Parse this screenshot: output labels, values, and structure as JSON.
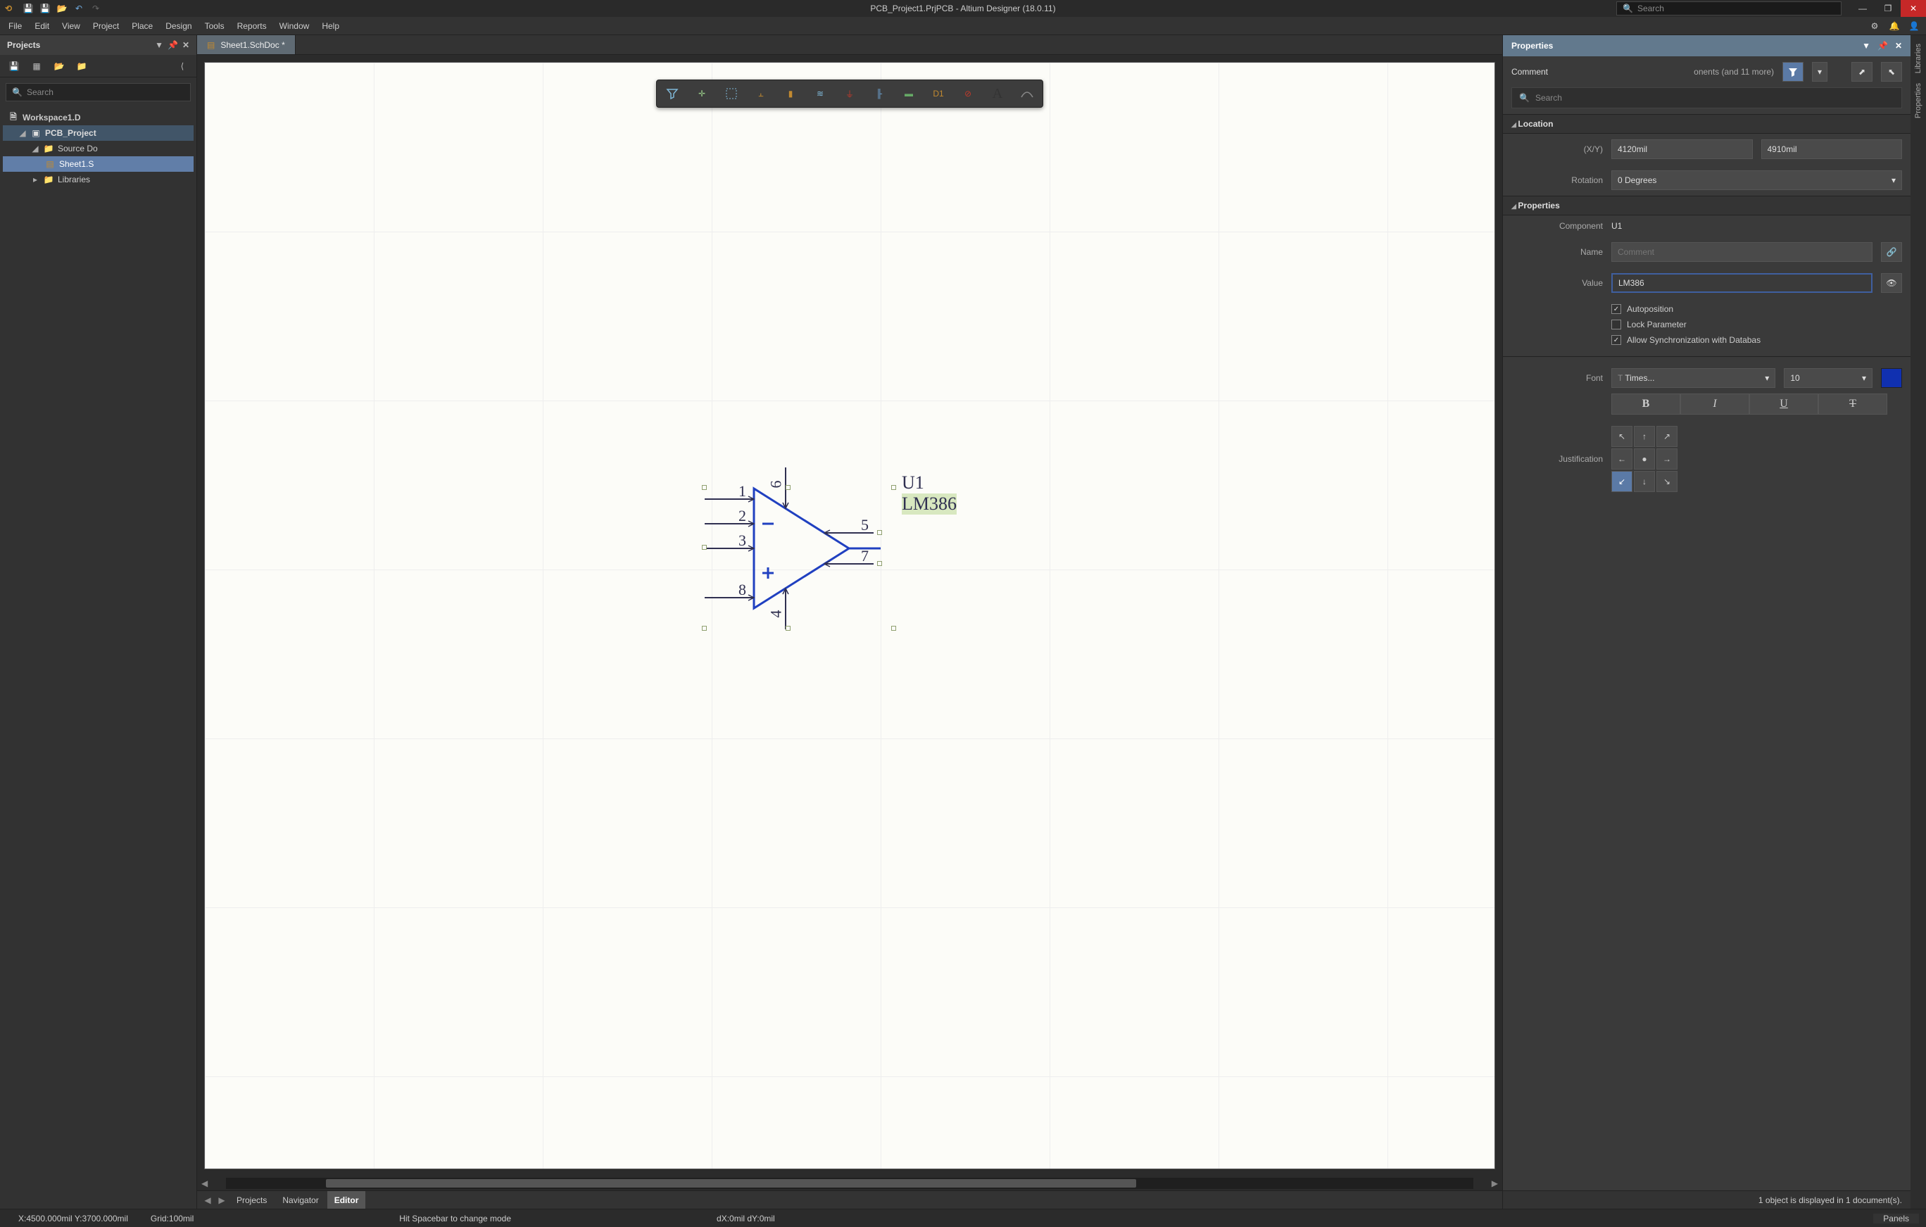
{
  "title": "PCB_Project1.PrjPCB - Altium Designer (18.0.11)",
  "global_search_placeholder": "Search",
  "menu": [
    "File",
    "Edit",
    "View",
    "Project",
    "Place",
    "Design",
    "Tools",
    "Reports",
    "Window",
    "Help"
  ],
  "projects_panel": {
    "title": "Projects",
    "search_placeholder": "Search",
    "workspace": "Workspace1.D",
    "project": "PCB_Project",
    "source_group": "Source Do",
    "sheet": "Sheet1.S",
    "libraries": "Libraries"
  },
  "open_tab": {
    "label": "Sheet1.SchDoc *"
  },
  "component": {
    "designator": "U1",
    "comment": "LM386",
    "pins": {
      "p1": "1",
      "p2": "2",
      "p3": "3",
      "p4": "4",
      "p5": "5",
      "p6": "6",
      "p7": "7",
      "p8": "8"
    }
  },
  "properties_panel": {
    "title": "Properties",
    "scope": "Comment",
    "filter_more": "onents (and 11 more)",
    "search_placeholder": "Search",
    "sections": {
      "location": "Location",
      "properties": "Properties"
    },
    "location": {
      "xy_label": "(X/Y)",
      "x": "4120mil",
      "y": "4910mil",
      "rotation_label": "Rotation",
      "rotation": "0 Degrees"
    },
    "prop": {
      "component_label": "Component",
      "component": "U1",
      "name_label": "Name",
      "name_placeholder": "Comment",
      "value_label": "Value",
      "value": "LM386",
      "autoposition": "Autoposition",
      "lock": "Lock Parameter",
      "allowsync": "Allow Synchronization with Databas",
      "font_label": "Font",
      "font_name": "Times...",
      "font_size": "10",
      "justification": "Justification"
    },
    "status": "1 object is displayed in 1 document(s)."
  },
  "bottom_tabs": {
    "projects": "Projects",
    "navigator": "Navigator",
    "editor": "Editor"
  },
  "dock_tabs": {
    "libraries": "Libraries",
    "properties": "Properties"
  },
  "status": {
    "coords": "X:4500.000mil Y:3700.000mil",
    "grid": "Grid:100mil",
    "hint": "Hit Spacebar to change mode",
    "delta": "dX:0mil dY:0mil",
    "panels": "Panels"
  }
}
